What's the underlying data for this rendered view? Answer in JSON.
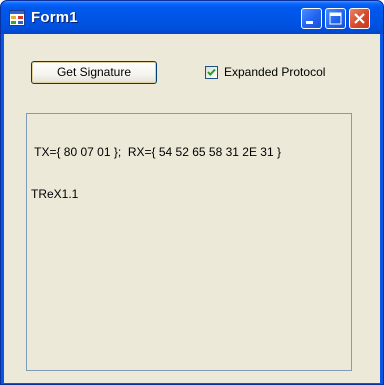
{
  "window": {
    "title": "Form1",
    "icon": "form-app-icon",
    "controls": {
      "minimize": "minimize-icon",
      "maximize": "maximize-icon",
      "close": "close-icon"
    }
  },
  "form": {
    "get_signature_label": "Get Signature",
    "expanded_protocol_label": "Expanded Protocol",
    "expanded_protocol_checked": true,
    "output_lines": [
      " TX={ 80 07 01 };  RX={ 54 52 65 58 31 2E 31 }",
      "TReX1.1"
    ]
  },
  "colors": {
    "titlebar": "#0055e6",
    "client_background": "#ece9d8",
    "button_border": "#003c74",
    "checkmark": "#21a121",
    "close_button": "#d8472a"
  }
}
